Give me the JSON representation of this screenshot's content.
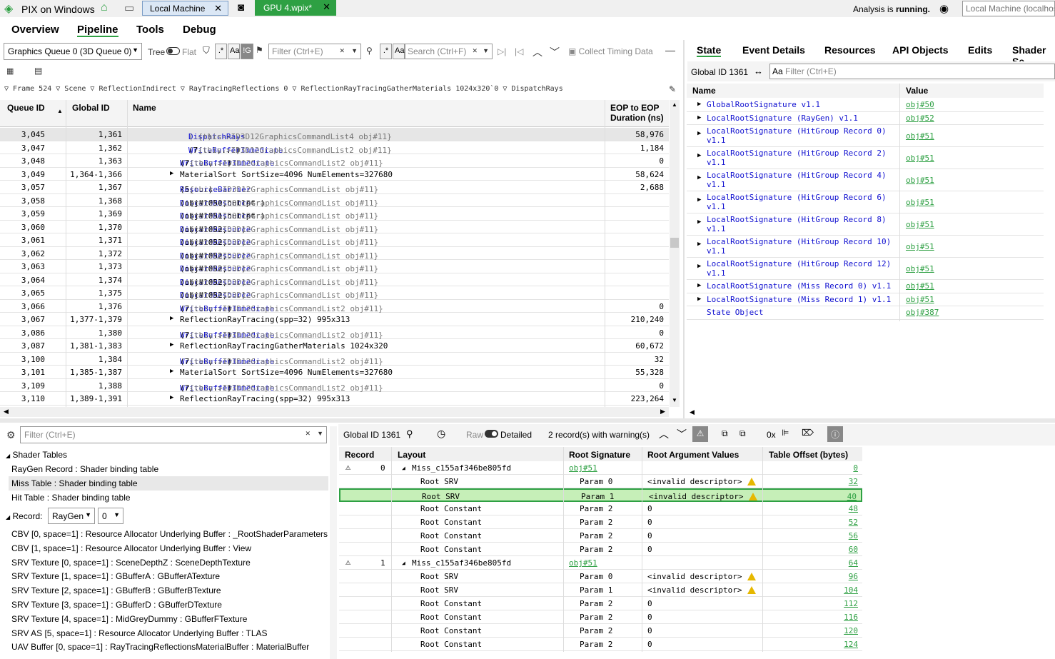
{
  "app": {
    "title": "PIX on Windows",
    "tab_local": "Local Machine",
    "tab_gpu": "GPU 4.wpix*",
    "analysis_prefix": "Analysis is",
    "analysis_state": "running.",
    "machine_combo": "Local Machine (localhos"
  },
  "menu": [
    "Overview",
    "Pipeline",
    "Tools",
    "Debug"
  ],
  "toolbar": {
    "queue": "Graphics Queue 0 (3D Queue 0)",
    "tree": "Tree",
    "flat": "Flat",
    "regex": ".*",
    "case": "Aa",
    "g_toggle": "!G",
    "filter_placeholder": "Filter (Ctrl+E)",
    "search_placeholder": "Search (Ctrl+F)",
    "collect": "Collect Timing Data"
  },
  "breadcrumb": [
    "Frame 524",
    "Scene",
    "ReflectionIndirect",
    "RayTracingReflections 0",
    "ReflectionRayTracingGatherMaterials 1024x320`0",
    "DispatchRays"
  ],
  "events": {
    "headers": {
      "queue": "Queue ID",
      "global": "Global ID",
      "name": "Name",
      "eop": "EOP to EOP",
      "duration": "Duration (ns)"
    },
    "rows": [
      {
        "q": "3,045",
        "g": "1,361",
        "fn": "DispatchRays",
        "args": "(...)",
        "ctx": "{this->ID3D12GraphicsCommandList4 obj#11}",
        "d": "58,976",
        "ind": 2,
        "sel": true
      },
      {
        "q": "3,047",
        "g": "1,362",
        "fn": "WriteBufferImmediate",
        "args": "(7,...,...)",
        "ctx": "{this->ID3D12GraphicsCommandList2 obj#11}",
        "d": "1,184",
        "ind": 2
      },
      {
        "q": "3,048",
        "g": "1,363",
        "fn": "WriteBufferImmediate",
        "args": "(7,...,...)",
        "ctx": "{this->ID3D12GraphicsCommandList2 obj#11}",
        "d": "0",
        "ind": 1
      },
      {
        "q": "3,049",
        "g": "1,364-1,366",
        "grp": "MaterialSort SortSize=4096 NumElements=327680",
        "d": "58,624"
      },
      {
        "q": "3,057",
        "g": "1,367",
        "fn": "ResourceBarrier",
        "args": "(5,...)",
        "ctx": "{this->ID3D12GraphicsCommandList obj#11}",
        "d": "2,688",
        "ind": 1
      },
      {
        "q": "3,058",
        "g": "1,368",
        "fn": "DiscardResource",
        "args": "(obj#1050,nullptr)",
        "ctx": "{this->ID3D12GraphicsCommandList obj#11}",
        "d": "",
        "ind": 1
      },
      {
        "q": "3,059",
        "g": "1,369",
        "fn": "DiscardResource",
        "args": "(obj#1051,nullptr)",
        "ctx": "{this->ID3D12GraphicsCommandList obj#11}",
        "d": "",
        "ind": 1
      },
      {
        "q": "3,060",
        "g": "1,370",
        "fn": "DiscardResource",
        "args": "(obj#1052,...)",
        "ctx": "{this->ID3D12GraphicsCommandList obj#11}",
        "d": "",
        "ind": 1
      },
      {
        "q": "3,061",
        "g": "1,371",
        "fn": "DiscardResource",
        "args": "(obj#1052,...)",
        "ctx": "{this->ID3D12GraphicsCommandList obj#11}",
        "d": "",
        "ind": 1
      },
      {
        "q": "3,062",
        "g": "1,372",
        "fn": "DiscardResource",
        "args": "(obj#1052,...)",
        "ctx": "{this->ID3D12GraphicsCommandList obj#11}",
        "d": "",
        "ind": 1
      },
      {
        "q": "3,063",
        "g": "1,373",
        "fn": "DiscardResource",
        "args": "(obj#1052,...)",
        "ctx": "{this->ID3D12GraphicsCommandList obj#11}",
        "d": "",
        "ind": 1
      },
      {
        "q": "3,064",
        "g": "1,374",
        "fn": "DiscardResource",
        "args": "(obj#1052,...)",
        "ctx": "{this->ID3D12GraphicsCommandList obj#11}",
        "d": "",
        "ind": 1
      },
      {
        "q": "3,065",
        "g": "1,375",
        "fn": "DiscardResource",
        "args": "(obj#1052,...)",
        "ctx": "{this->ID3D12GraphicsCommandList obj#11}",
        "d": "",
        "ind": 1
      },
      {
        "q": "3,066",
        "g": "1,376",
        "fn": "WriteBufferImmediate",
        "args": "(7,...,...)",
        "ctx": "{this->ID3D12GraphicsCommandList2 obj#11}",
        "d": "0",
        "ind": 1
      },
      {
        "q": "3,067",
        "g": "1,377-1,379",
        "grp": "ReflectionRayTracing(spp=32) 995x313",
        "d": "210,240"
      },
      {
        "q": "3,086",
        "g": "1,380",
        "fn": "WriteBufferImmediate",
        "args": "(7,...,...)",
        "ctx": "{this->ID3D12GraphicsCommandList2 obj#11}",
        "d": "0",
        "ind": 1
      },
      {
        "q": "3,087",
        "g": "1,381-1,383",
        "grp": "ReflectionRayTracingGatherMaterials 1024x320",
        "d": "60,672"
      },
      {
        "q": "3,100",
        "g": "1,384",
        "fn": "WriteBufferImmediate",
        "args": "(7,...,...)",
        "ctx": "{this->ID3D12GraphicsCommandList2 obj#11}",
        "d": "32",
        "ind": 1
      },
      {
        "q": "3,101",
        "g": "1,385-1,387",
        "grp": "MaterialSort SortSize=4096 NumElements=327680",
        "d": "55,328"
      },
      {
        "q": "3,109",
        "g": "1,388",
        "fn": "WriteBufferImmediate",
        "args": "(7,...,...)",
        "ctx": "{this->ID3D12GraphicsCommandList2 obj#11}",
        "d": "0",
        "ind": 1
      },
      {
        "q": "3,110",
        "g": "1,389-1,391",
        "grp": "ReflectionRayTracing(spp=32) 995x313",
        "d": "223,264"
      }
    ]
  },
  "state_tabs": [
    "State",
    "Event Details",
    "Resources",
    "API Objects",
    "Edits",
    "Shader Se"
  ],
  "state": {
    "global_id": "Global ID 1361",
    "aa": "Aa",
    "filter_placeholder": "Filter (Ctrl+E)",
    "col_name": "Name",
    "col_value": "Value",
    "rows": [
      {
        "n": "GlobalRootSignature v1.1",
        "v": "obj#50",
        "tri": true
      },
      {
        "n": "LocalRootSignature (RayGen) v1.1",
        "v": "obj#52",
        "tri": true
      },
      {
        "n": "LocalRootSignature (HitGroup Record 0)",
        "n2": "v1.1",
        "v": "obj#51",
        "tri": true
      },
      {
        "n": "LocalRootSignature (HitGroup Record 2)",
        "n2": "v1.1",
        "v": "obj#51",
        "tri": true
      },
      {
        "n": "LocalRootSignature (HitGroup Record 4)",
        "n2": "v1.1",
        "v": "obj#51",
        "tri": true
      },
      {
        "n": "LocalRootSignature (HitGroup Record 6)",
        "n2": "v1.1",
        "v": "obj#51",
        "tri": true
      },
      {
        "n": "LocalRootSignature (HitGroup Record 8)",
        "n2": "v1.1",
        "v": "obj#51",
        "tri": true
      },
      {
        "n": "LocalRootSignature (HitGroup Record 10)",
        "n2": "v1.1",
        "v": "obj#51",
        "tri": true
      },
      {
        "n": "LocalRootSignature (HitGroup Record 12)",
        "n2": "v1.1",
        "v": "obj#51",
        "tri": true
      },
      {
        "n": "LocalRootSignature (Miss Record 0) v1.1",
        "v": "obj#51",
        "tri": true
      },
      {
        "n": "LocalRootSignature (Miss Record 1) v1.1",
        "v": "obj#51",
        "tri": true
      },
      {
        "n": "State Object",
        "v": "obj#387",
        "tri": false
      }
    ]
  },
  "left": {
    "filter_placeholder": "Filter (Ctrl+E)",
    "shader_tables": "Shader Tables",
    "tables": [
      "RayGen Record : Shader binding table",
      "Miss Table : Shader binding table",
      "Hit Table : Shader binding table"
    ],
    "record_label": "Record:",
    "record_type": "RayGen",
    "record_index": "0",
    "bindings": [
      "CBV [0, space=1] : Resource Allocator Underlying Buffer : _RootShaderParameters",
      "CBV [1, space=1] : Resource Allocator Underlying Buffer : View",
      "SRV Texture [0, space=1] : SceneDepthZ : SceneDepthTexture",
      "SRV Texture [1, space=1] : GBufferA : GBufferATexture",
      "SRV Texture [2, space=1] : GBufferB : GBufferBTexture",
      "SRV Texture [3, space=1] : GBufferD : GBufferDTexture",
      "SRV Texture [4, space=1] : MidGreyDummy : GBufferFTexture",
      "SRV AS [5, space=1] : Resource Allocator Underlying Buffer : TLAS",
      "UAV Buffer [0, space=1] : RayTracingReflectionsMaterialBuffer : MaterialBuffer"
    ]
  },
  "records": {
    "global_id": "Global ID 1361",
    "raw": "Raw",
    "detailed": "Detailed",
    "warnings": "2 record(s) with warning(s)",
    "hex": "0x",
    "headers": [
      "Record",
      "Layout",
      "Root Signature",
      "Root Argument Values",
      "Table Offset (bytes)"
    ],
    "rows": [
      {
        "rec": "0",
        "layout": "Miss_c155af346be805fd",
        "sig": "obj#51",
        "val": "",
        "off": "0",
        "group": true
      },
      {
        "layout": "Root SRV",
        "param": "Param 0",
        "val": "<invalid descriptor>",
        "warn": true,
        "off": "32"
      },
      {
        "layout": "Root SRV",
        "param": "Param 1",
        "val": "<invalid descriptor>",
        "warn": true,
        "off": "40",
        "sel": true
      },
      {
        "layout": "Root Constant",
        "param": "Param 2",
        "val": "0",
        "off": "48"
      },
      {
        "layout": "Root Constant",
        "param": "Param 2",
        "val": "0",
        "off": "52"
      },
      {
        "layout": "Root Constant",
        "param": "Param 2",
        "val": "0",
        "off": "56"
      },
      {
        "layout": "Root Constant",
        "param": "Param 2",
        "val": "0",
        "off": "60"
      },
      {
        "rec": "1",
        "layout": "Miss_c155af346be805fd",
        "sig": "obj#51",
        "val": "",
        "off": "64",
        "group": true
      },
      {
        "layout": "Root SRV",
        "param": "Param 0",
        "val": "<invalid descriptor>",
        "warn": true,
        "off": "96"
      },
      {
        "layout": "Root SRV",
        "param": "Param 1",
        "val": "<invalid descriptor>",
        "warn": true,
        "off": "104"
      },
      {
        "layout": "Root Constant",
        "param": "Param 2",
        "val": "0",
        "off": "112"
      },
      {
        "layout": "Root Constant",
        "param": "Param 2",
        "val": "0",
        "off": "116"
      },
      {
        "layout": "Root Constant",
        "param": "Param 2",
        "val": "0",
        "off": "120"
      },
      {
        "layout": "Root Constant",
        "param": "Param 2",
        "val": "0",
        "off": "124"
      }
    ]
  }
}
